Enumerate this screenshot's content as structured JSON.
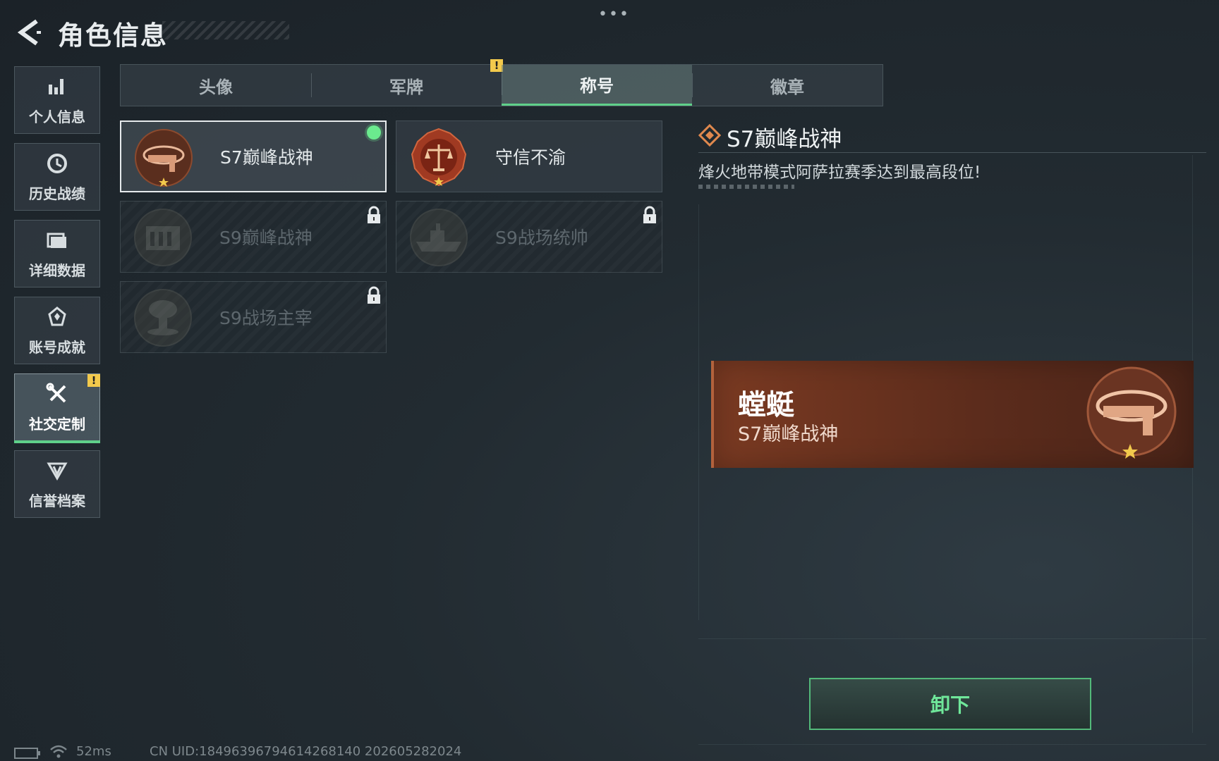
{
  "header": {
    "title": "角色信息",
    "more": "•••"
  },
  "sidebar": {
    "items": [
      {
        "label": "个人信息",
        "icon": "bar-chart-icon"
      },
      {
        "label": "历史战绩",
        "icon": "clock-icon"
      },
      {
        "label": "详细数据",
        "icon": "folder-icon"
      },
      {
        "label": "账号成就",
        "icon": "achievement-icon"
      },
      {
        "label": "社交定制",
        "icon": "tools-icon",
        "active": true,
        "alert": "!"
      },
      {
        "label": "信誉档案",
        "icon": "reputation-icon"
      }
    ]
  },
  "tabs": [
    {
      "label": "头像"
    },
    {
      "label": "军牌",
      "alert": "!"
    },
    {
      "label": "称号",
      "active": true
    },
    {
      "label": "徽章"
    }
  ],
  "titles": [
    {
      "name": "S7巅峰战神",
      "selected": true,
      "equipped": true
    },
    {
      "name": "守信不渝"
    },
    {
      "name": "S9巅峰战神",
      "locked": true
    },
    {
      "name": "S9战场统帅",
      "locked": true
    },
    {
      "name": "S9战场主宰",
      "locked": true
    }
  ],
  "detail": {
    "title": "S7巅峰战神",
    "description": "烽火地带模式阿萨拉赛季达到最高段位!"
  },
  "preview": {
    "player_name": "螳蜓",
    "title": "S7巅峰战神"
  },
  "unequip_button": "卸下",
  "status": {
    "ping": "52ms",
    "uid": "CN UID:18496396794614268140 202605282024"
  },
  "colors": {
    "accent_green": "#5fd08a",
    "warning_yellow": "#f2c94c",
    "banner_brown": "#7a3a22"
  }
}
